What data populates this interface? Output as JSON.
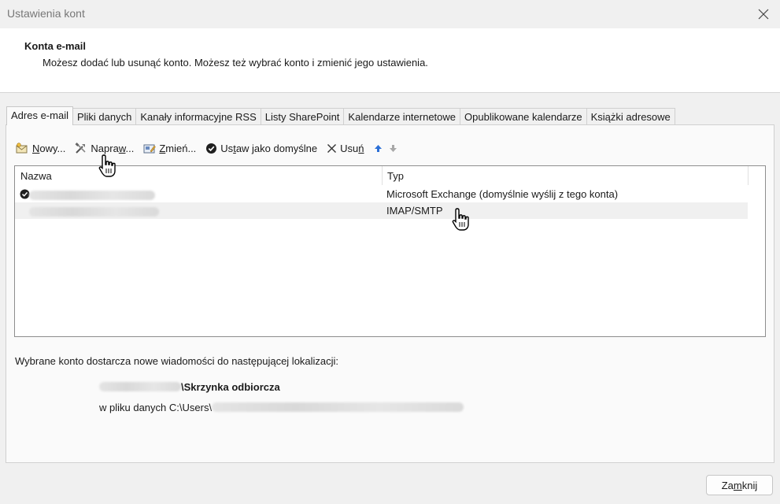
{
  "window": {
    "title": "Ustawienia kont"
  },
  "header": {
    "title": "Konta e-mail",
    "description": "Możesz dodać lub usunąć konto. Możesz też wybrać konto i zmienić jego ustawienia."
  },
  "tabs": [
    {
      "label": "Adres e-mail",
      "active": true
    },
    {
      "label": "Pliki danych"
    },
    {
      "label": "Kanały informacyjne RSS"
    },
    {
      "label": "Listy SharePoint"
    },
    {
      "label": "Kalendarze internetowe"
    },
    {
      "label": "Opublikowane kalendarze"
    },
    {
      "label": "Książki adresowe"
    }
  ],
  "toolbar": {
    "new_pre": "",
    "new_u": "N",
    "new_post": "owy...",
    "repair_pre": "Napra",
    "repair_u": "w",
    "repair_post": "...",
    "change_pre": "",
    "change_u": "Z",
    "change_post": "mień...",
    "default_pre": "Us",
    "default_u": "t",
    "default_post": "aw jako domyślne",
    "remove_pre": "Usu",
    "remove_u": "ń",
    "remove_post": "",
    "icons": [
      "new-account-icon",
      "repair-tools-icon",
      "change-icon",
      "checkmark-icon",
      "x-icon",
      "arrow-up-icon",
      "arrow-down-icon"
    ]
  },
  "list": {
    "columns": {
      "name": "Nazwa",
      "type": "Typ"
    },
    "rows": [
      {
        "type": "Microsoft Exchange (domyślnie wyślij z tego konta)",
        "default": true,
        "selected": false
      },
      {
        "type": "IMAP/SMTP",
        "default": false,
        "selected": true
      }
    ]
  },
  "delivery": {
    "label": "Wybrane konto dostarcza nowe wiadomości do następującej lokalizacji:",
    "folder": "\\Skrzynka odbiorcza",
    "datafile_prefix": "w pliku danych C:\\Users\\"
  },
  "footer": {
    "close_pre": "Za",
    "close_u": "m",
    "close_post": "knij"
  },
  "colors": {
    "window_bg": "#f0f0f0",
    "panel_bg": "#fafafa",
    "selected_row": "#f0f0f0",
    "arrow_blue": "#2b6fd6"
  }
}
